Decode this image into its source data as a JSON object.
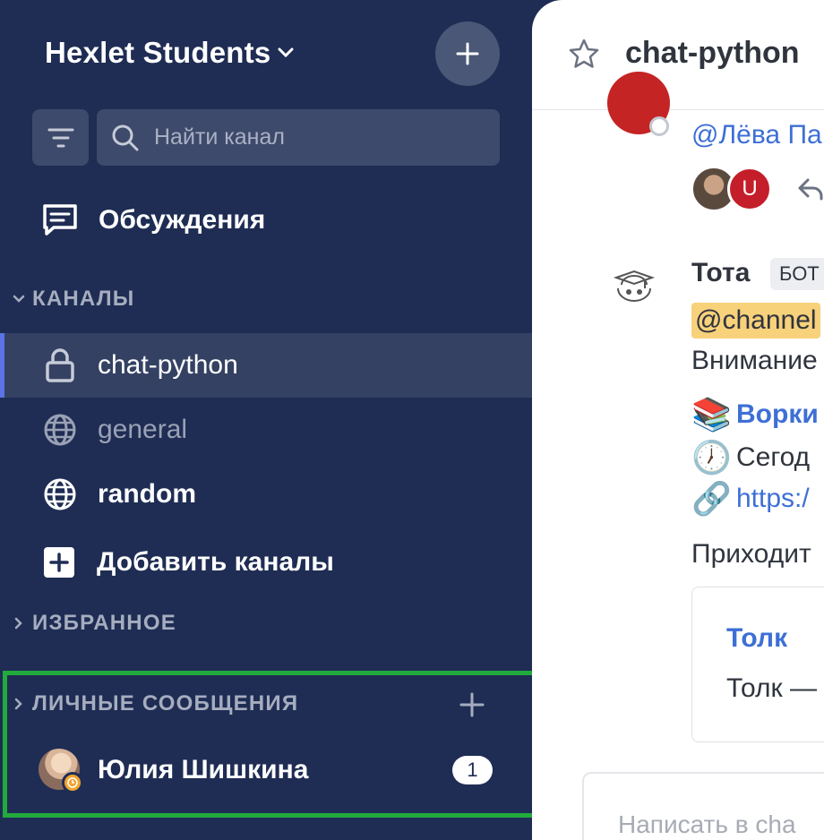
{
  "sidebar": {
    "workspace_title": "Hexlet Students",
    "search_placeholder": "Найти канал",
    "discussions_label": "Обсуждения",
    "channels_section": "КАНАЛЫ",
    "channels": [
      {
        "name": "chat-python",
        "icon": "lock-icon",
        "active": true
      },
      {
        "name": "general",
        "icon": "globe-icon",
        "muted": true
      },
      {
        "name": "random",
        "icon": "globe-icon",
        "bold": true
      }
    ],
    "add_channels_label": "Добавить каналы",
    "favorites_section": "ИЗБРАННОЕ",
    "dm_section": "ЛИЧНЫЕ СООБЩЕНИЯ",
    "dms": [
      {
        "name": "Юлия Шишкина",
        "unread": "1",
        "status": "away"
      }
    ]
  },
  "main": {
    "channel_title": "chat-python",
    "mention_user": "@Лёва Па",
    "reactor_initial": "U",
    "bot": {
      "name": "Тота",
      "tag": "БОТ",
      "mention": "@channel",
      "line1": "Внимание",
      "items": [
        {
          "emoji": "📚",
          "text": "Ворки",
          "style": "bold-link"
        },
        {
          "emoji": "🕖",
          "text": "Сегод",
          "style": "plain"
        },
        {
          "emoji": "🔗",
          "text": "https:/",
          "style": "link"
        }
      ],
      "line_after": "Приходит",
      "preview_title": "Толк",
      "preview_desc": "Толк —"
    },
    "composer_placeholder": "Написать в cha"
  },
  "colors": {
    "sidebar_bg": "#1f2d54",
    "active_accent": "#5a73e6",
    "highlight_box": "#22aa3c",
    "link": "#3d6fd6",
    "mention_bg": "#f8d17b"
  }
}
